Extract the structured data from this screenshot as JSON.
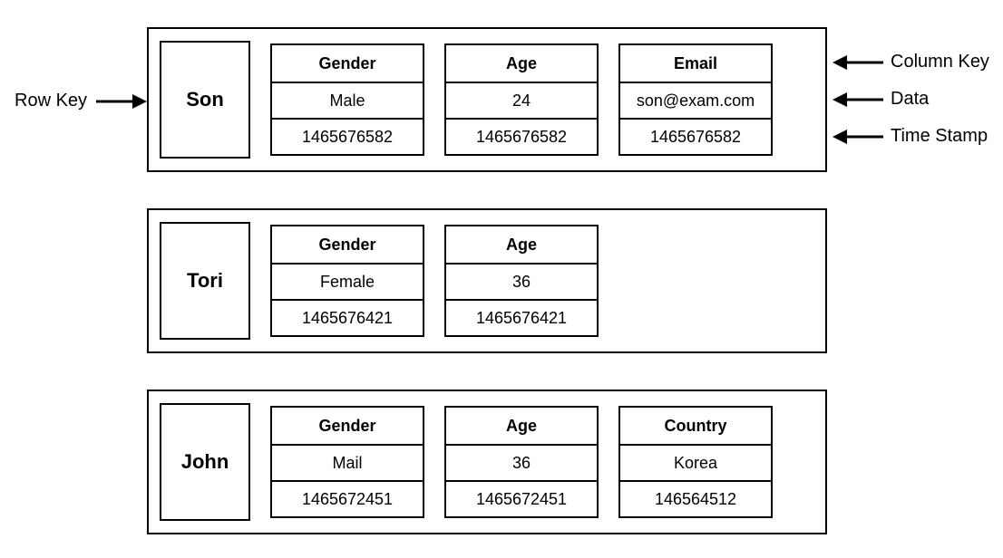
{
  "labels": {
    "row_key": "Row Key",
    "column_key": "Column Key",
    "data": "Data",
    "timestamp": "Time Stamp"
  },
  "rows": [
    {
      "key": "Son",
      "cols": [
        {
          "key": "Gender",
          "value": "Male",
          "ts": "1465676582"
        },
        {
          "key": "Age",
          "value": "24",
          "ts": "1465676582"
        },
        {
          "key": "Email",
          "value": "son@exam.com",
          "ts": "1465676582"
        }
      ]
    },
    {
      "key": "Tori",
      "cols": [
        {
          "key": "Gender",
          "value": "Female",
          "ts": "1465676421"
        },
        {
          "key": "Age",
          "value": "36",
          "ts": "1465676421"
        }
      ]
    },
    {
      "key": "John",
      "cols": [
        {
          "key": "Gender",
          "value": "Mail",
          "ts": "1465672451"
        },
        {
          "key": "Age",
          "value": "36",
          "ts": "1465672451"
        },
        {
          "key": "Country",
          "value": "Korea",
          "ts": "146564512"
        }
      ]
    }
  ]
}
